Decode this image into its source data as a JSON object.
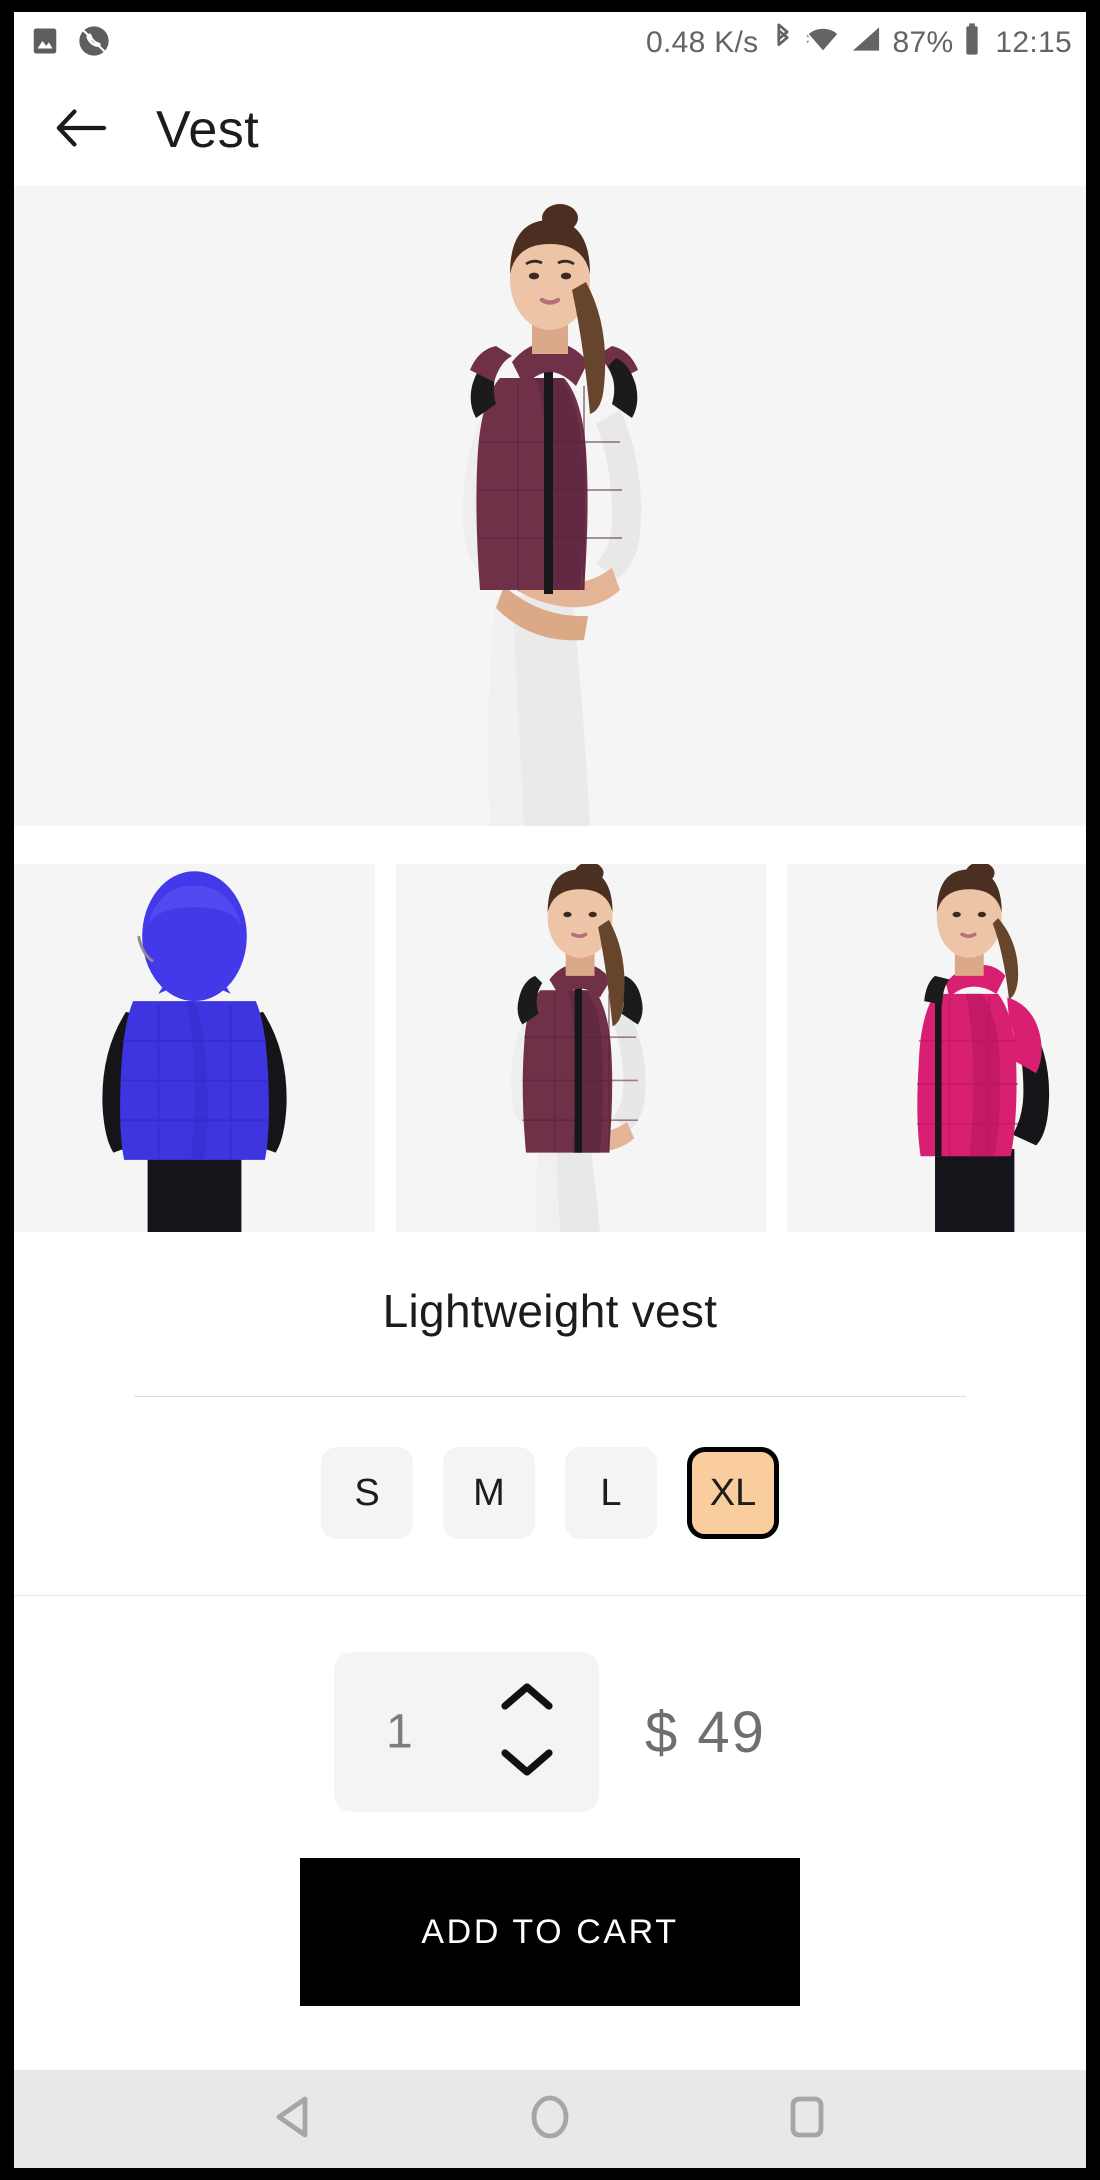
{
  "status_bar": {
    "icons_left": [
      "image-icon",
      "missed-call-icon"
    ],
    "network_speed": "0.48 K/s",
    "icons_right": [
      "bluetooth-icon",
      "wifi-icon",
      "signal-icon"
    ],
    "battery_percent": "87%",
    "battery_icon": "battery-icon",
    "time": "12:15"
  },
  "app_bar": {
    "back_icon": "arrow-left-icon",
    "title": "Vest"
  },
  "gallery": {
    "hero": {
      "alt": "Woman wearing maroon lightweight vest over white top",
      "vest_color": "#6f3048",
      "background": "#f5f5f5"
    },
    "thumbnails": [
      {
        "alt": "Blue hooded vest back view",
        "vest_color": "#3f35e0"
      },
      {
        "alt": "Maroon vest front view",
        "vest_color": "#6f3048"
      },
      {
        "alt": "Pink vest side view",
        "vest_color": "#d81f72"
      }
    ]
  },
  "product": {
    "title": "Lightweight vest",
    "sizes": [
      {
        "label": "S",
        "selected": false
      },
      {
        "label": "M",
        "selected": false
      },
      {
        "label": "L",
        "selected": false
      },
      {
        "label": "XL",
        "selected": true
      }
    ],
    "selected_size": "XL",
    "quantity": "1",
    "currency_symbol": "$",
    "price": "49",
    "price_display": "$ 49",
    "add_to_cart_label": "ADD TO CART"
  },
  "colors": {
    "selected_size_bg": "#f9cd9d",
    "selected_size_border": "#000000",
    "unselected_size_bg": "#f4f4f4",
    "cart_button_bg": "#000000",
    "cart_button_text": "#ffffff",
    "price_text": "#6f6f6f",
    "gallery_bg": "#f5f5f5",
    "nav_bar_bg": "#e8e8e8"
  },
  "nav_bar": {
    "back_icon": "triangle-back-icon",
    "home_icon": "circle-home-icon",
    "recents_icon": "square-recents-icon"
  }
}
